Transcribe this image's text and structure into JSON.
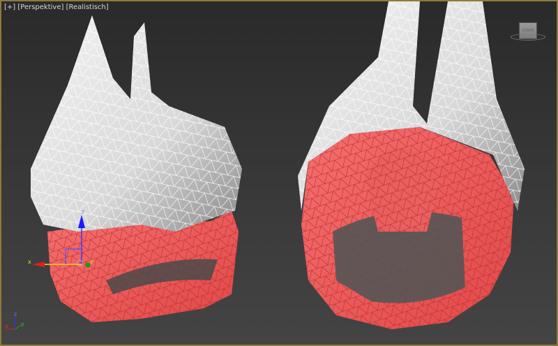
{
  "viewport": {
    "menu_plus": "[+]",
    "view_mode": "[Perspektive]",
    "shading_mode": "[Realistisch]"
  },
  "viewcube": {
    "face_label": "VORNE"
  },
  "gizmo": {
    "x": "x",
    "y": "y",
    "z": "z"
  },
  "axis_tripod": {
    "x": "x",
    "y": "y",
    "z": "z"
  },
  "colors": {
    "border": "#8e7a3a",
    "selected_mesh": "#f05a5a",
    "helmet": "#e8e8e8"
  }
}
